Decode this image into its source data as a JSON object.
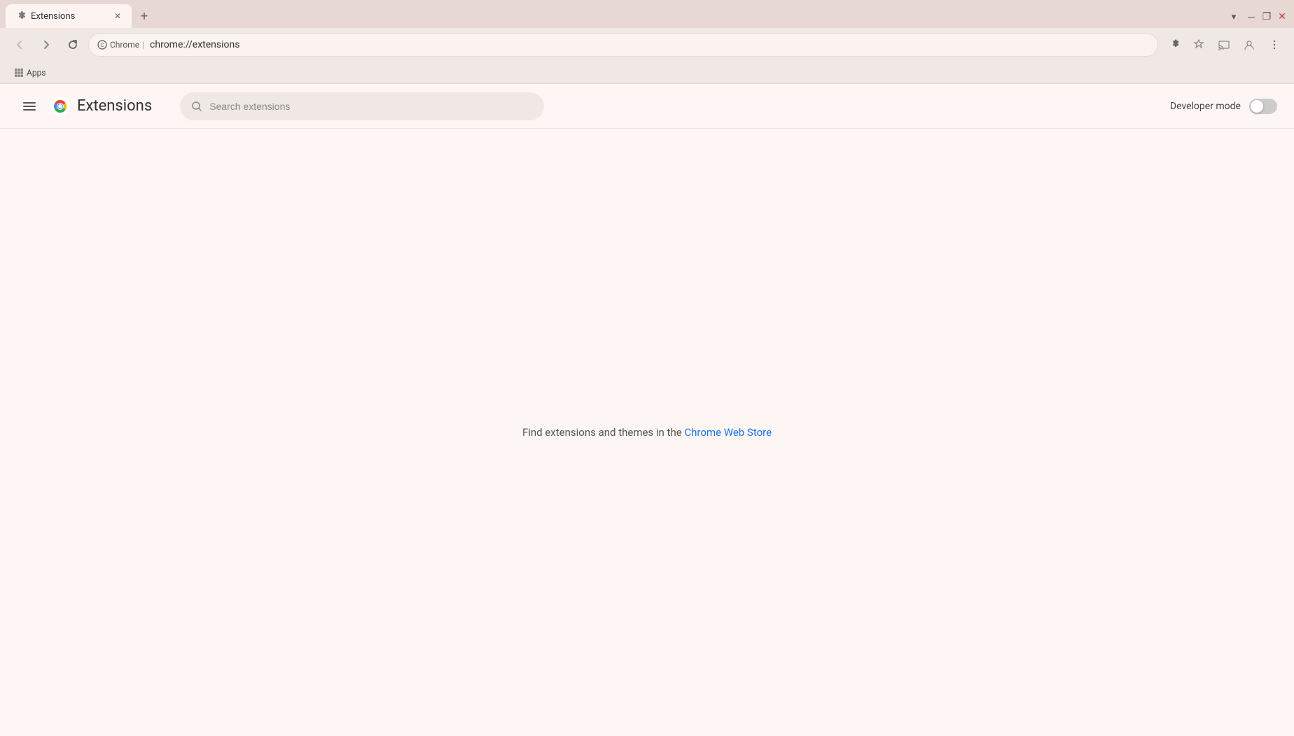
{
  "browser": {
    "tab": {
      "label": "Extensions",
      "favicon": "puzzle"
    },
    "new_tab_label": "+",
    "address": {
      "security_label": "Chrome",
      "url": "chrome://extensions"
    }
  },
  "bookmarks": {
    "apps_label": "Apps"
  },
  "extensions_page": {
    "title": "Extensions",
    "search": {
      "placeholder": "Search extensions"
    },
    "developer_mode_label": "Developer mode",
    "empty_state": {
      "text": "Find extensions and themes in the ",
      "link_text": "Chrome Web Store"
    }
  }
}
